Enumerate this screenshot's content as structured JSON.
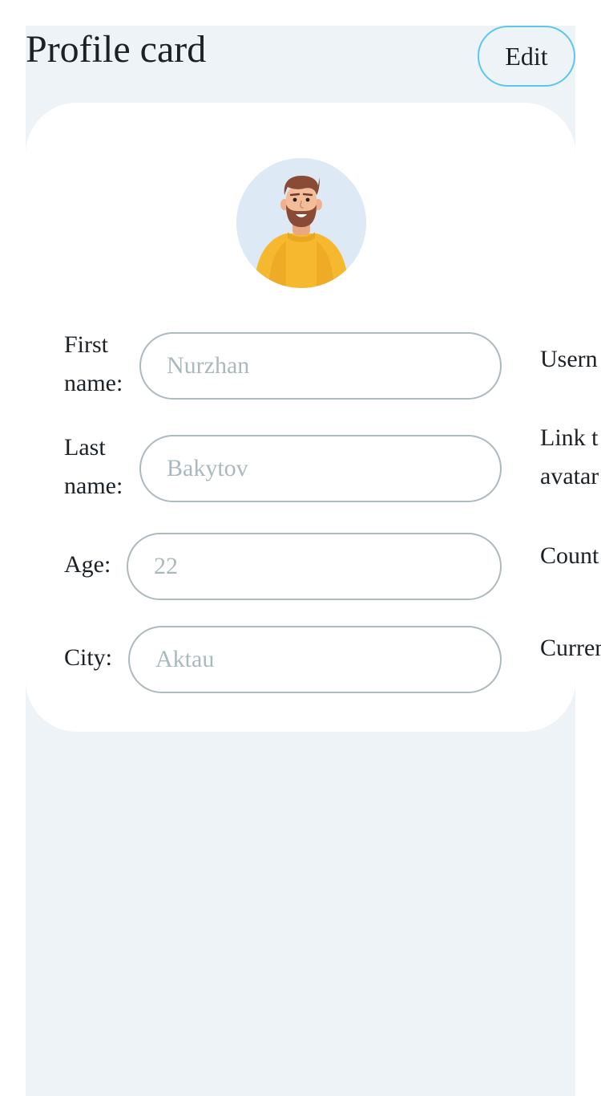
{
  "header": {
    "title": "Profile card",
    "edit_label": "Edit"
  },
  "avatar": {
    "icon": "person-avatar-icon",
    "background": "#dde9f5",
    "shirt_color": "#f5b82e"
  },
  "form": {
    "first_name": {
      "label": "First name:",
      "placeholder": "Nurzhan"
    },
    "last_name": {
      "label": "Last name:",
      "placeholder": "Bakytov"
    },
    "age": {
      "label": "Age:",
      "placeholder": "22"
    },
    "city": {
      "label": "City:",
      "placeholder": "Aktau"
    }
  },
  "right_column": {
    "username_label": "Usern",
    "avatar_link_label_line1": "Link t",
    "avatar_link_label_line2": "avatar",
    "country_label": "Count",
    "current_label": "Curren"
  },
  "colors": {
    "page_background": "#edf3f6",
    "card_background": "#ffffff",
    "edit_border": "#5bc7ec",
    "field_border": "#aeb9be",
    "placeholder": "#aab9bd",
    "text": "#1c2126"
  }
}
